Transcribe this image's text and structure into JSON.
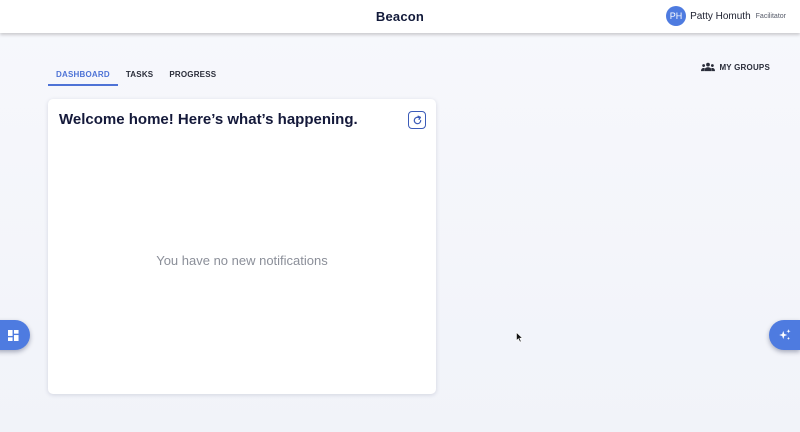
{
  "header": {
    "app_title": "Beacon",
    "user": {
      "initials": "PH",
      "name": "Patty Homuth",
      "role": "Facilitator"
    }
  },
  "tabs": [
    {
      "label": "DASHBOARD",
      "active": true
    },
    {
      "label": "TASKS",
      "active": false
    },
    {
      "label": "PROGRESS",
      "active": false
    }
  ],
  "my_groups": {
    "label": "MY GROUPS",
    "icon": "groups-icon"
  },
  "card": {
    "title": "Welcome home! Here’s what’s happening.",
    "refresh_icon": "refresh-icon",
    "empty_message": "You have no new notifications"
  },
  "floating": {
    "left_icon": "dashboard-grid-icon",
    "right_icon": "sparkles-icon"
  },
  "colors": {
    "accent": "#4e7be0",
    "tab_active": "#4e73d6",
    "title_text": "#14193a",
    "muted_text": "#8b8f99"
  }
}
